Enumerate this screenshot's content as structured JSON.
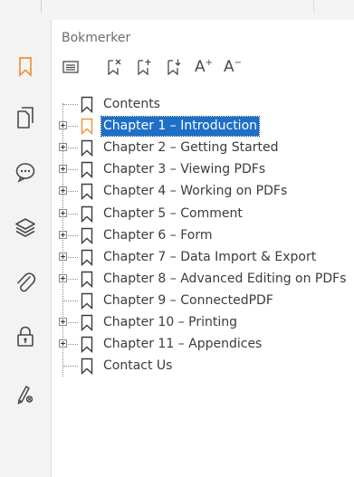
{
  "panel": {
    "title": "Bokmerker"
  },
  "toolbar": {
    "font_increase_label": "A",
    "font_increase_sup": "+",
    "font_decrease_label": "A",
    "font_decrease_sup": "−",
    "icons": [
      "options-menu-icon",
      "delete-bookmark-icon",
      "add-bookmark-icon",
      "add-child-bookmark-icon",
      "increase-font-icon",
      "decrease-font-icon"
    ]
  },
  "rail": {
    "icons": [
      "bookmark-icon",
      "pages-icon",
      "comments-icon",
      "layers-icon",
      "attachments-icon",
      "security-icon",
      "signature-icon"
    ],
    "active": "bookmark-icon"
  },
  "bookmarks": [
    {
      "label": "Contents",
      "expandable": false,
      "selected": false
    },
    {
      "label": "Chapter 1 – Introduction",
      "expandable": true,
      "selected": true
    },
    {
      "label": "Chapter 2 – Getting Started",
      "expandable": true,
      "selected": false
    },
    {
      "label": "Chapter 3 – Viewing PDFs",
      "expandable": true,
      "selected": false
    },
    {
      "label": "Chapter 4 – Working on PDFs",
      "expandable": true,
      "selected": false
    },
    {
      "label": "Chapter 5 – Comment",
      "expandable": true,
      "selected": false
    },
    {
      "label": "Chapter 6 – Form",
      "expandable": true,
      "selected": false
    },
    {
      "label": "Chapter 7 – Data Import & Export",
      "expandable": true,
      "selected": false
    },
    {
      "label": "Chapter 8 – Advanced Editing on PDFs",
      "expandable": true,
      "selected": false
    },
    {
      "label": "Chapter 9 – ConnectedPDF",
      "expandable": false,
      "selected": false
    },
    {
      "label": "Chapter 10 – Printing",
      "expandable": true,
      "selected": false
    },
    {
      "label": "Chapter 11 – Appendices",
      "expandable": true,
      "selected": false
    },
    {
      "label": "Contact Us",
      "expandable": false,
      "selected": false
    }
  ],
  "colors": {
    "accent_orange": "#f0913a",
    "selection_blue": "#1e6fc8",
    "icon_gray": "#4a4a4a"
  }
}
